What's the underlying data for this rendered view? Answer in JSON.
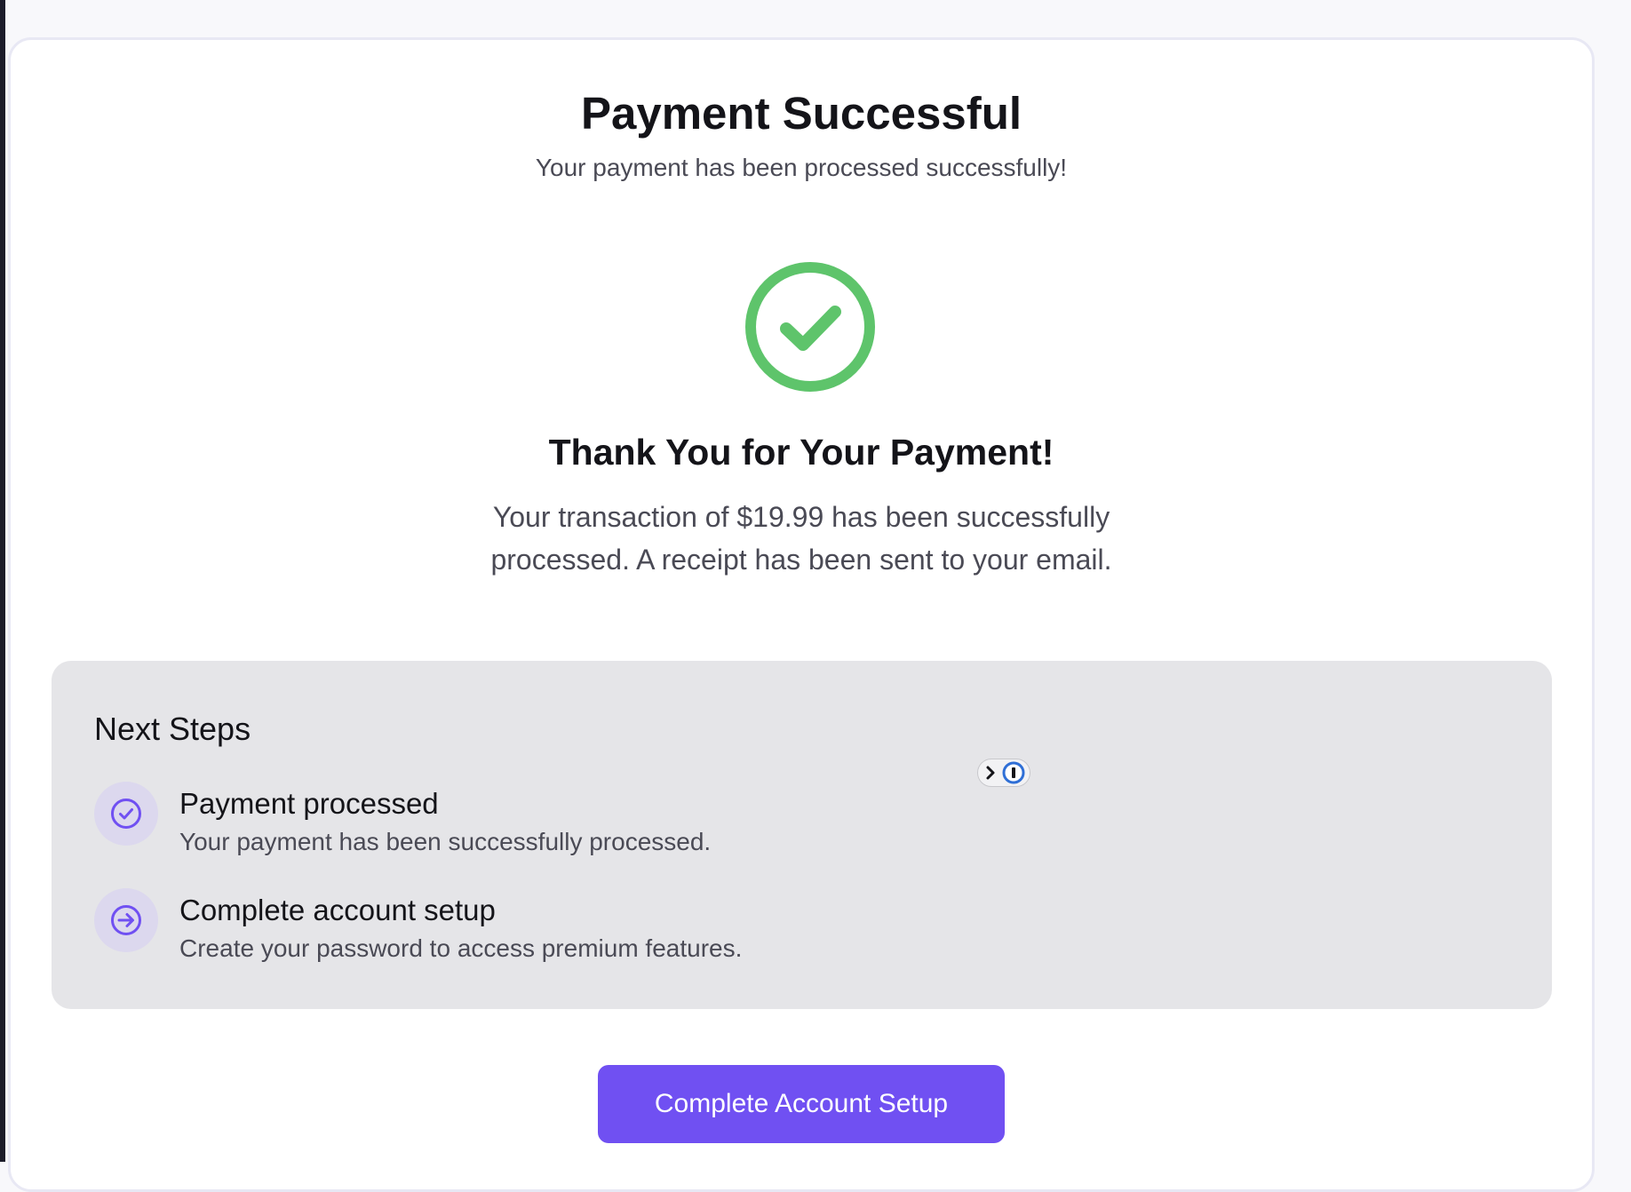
{
  "header": {
    "title": "Payment Successful",
    "subtitle": "Your payment has been processed successfully!"
  },
  "status": {
    "icon": "check-circle-icon",
    "color": "#5ec46b"
  },
  "confirmation": {
    "title": "Thank You for Your Payment!",
    "message": "Your transaction of $19.99 has been successfully processed. A receipt has been sent to your email."
  },
  "next_steps": {
    "title": "Next Steps",
    "items": [
      {
        "icon": "check-circle-icon",
        "title": "Payment processed",
        "description": "Your payment has been successfully processed."
      },
      {
        "icon": "arrow-right-circle-icon",
        "title": "Complete account setup",
        "description": "Create your password to access premium features."
      }
    ]
  },
  "extension_badge": {
    "icon": "password-manager-icon"
  },
  "actions": {
    "primary_label": "Complete Account Setup"
  },
  "colors": {
    "accent": "#7050f2",
    "success": "#5ec46b",
    "panel_background": "#e5e5e8",
    "icon_background": "#dcd8ee"
  }
}
